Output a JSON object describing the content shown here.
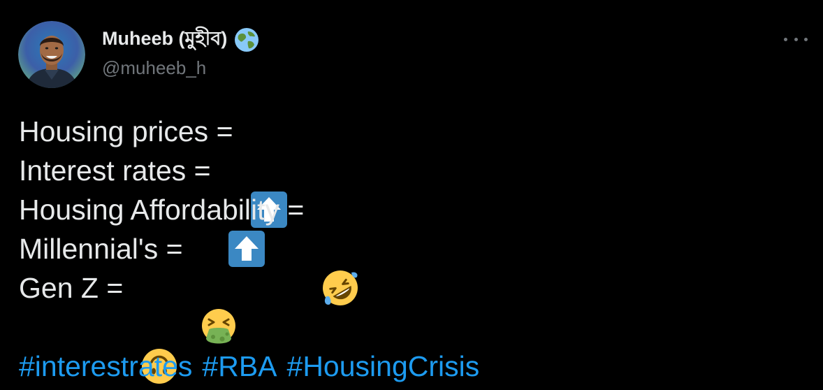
{
  "author": {
    "display_name": "Muheeb (মুহীব)",
    "handle": "@muheeb_h",
    "name_icon": "globe-icon"
  },
  "menu": {
    "icon": "more-horizontal-icon"
  },
  "tweet": {
    "lines": [
      {
        "text": "Housing prices = ",
        "emoji": "up-arrow-icon"
      },
      {
        "text": "Interest rates = ",
        "emoji": "up-arrow-icon"
      },
      {
        "text": "Housing Affordability = ",
        "emoji": "rofl-face-icon"
      },
      {
        "text": "Millennial's = ",
        "emoji": "vomiting-face-icon"
      },
      {
        "text": "Gen Z = ",
        "emoji": "upside-down-face-icon"
      }
    ],
    "hashtags": [
      "#interestrates",
      "#RBA",
      "#HousingCrisis"
    ]
  },
  "colors": {
    "background": "#000000",
    "text": "#e7e9ea",
    "secondary_text": "#71767b",
    "link": "#1d9bf0",
    "arrow_box": "#3b88c3"
  }
}
